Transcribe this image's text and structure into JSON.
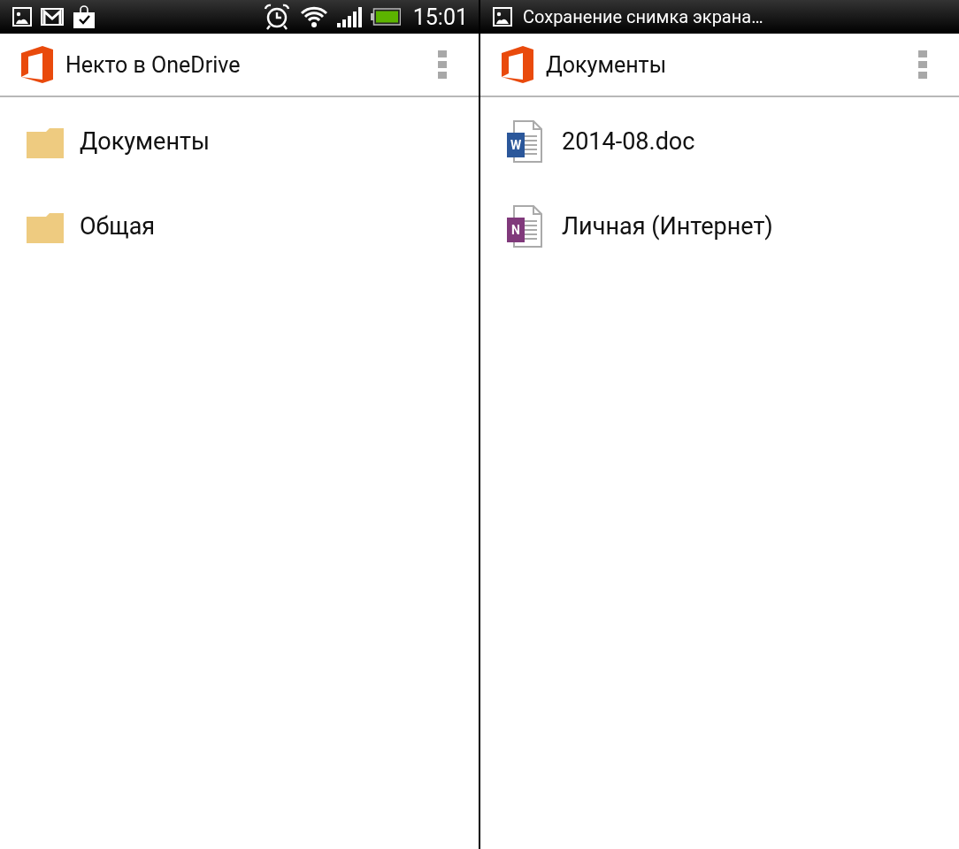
{
  "screens": [
    {
      "status_bar": {
        "kind": "icons",
        "time": "15:01"
      },
      "app_bar": {
        "title": "Некто в OneDrive"
      },
      "items": [
        {
          "kind": "folder",
          "name": "Документы"
        },
        {
          "kind": "folder",
          "name": "Общая"
        }
      ]
    },
    {
      "status_bar": {
        "kind": "ticker",
        "notification_text": "Сохранение снимка экрана…"
      },
      "app_bar": {
        "title": "Документы"
      },
      "items": [
        {
          "kind": "word",
          "letter": "W",
          "name": "2014-08.doc"
        },
        {
          "kind": "onenote",
          "letter": "N",
          "name": "Личная (Интернет)"
        }
      ]
    }
  ]
}
